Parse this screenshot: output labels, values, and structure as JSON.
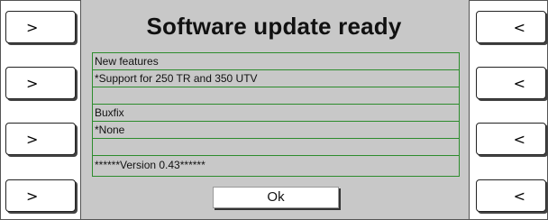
{
  "dialog": {
    "title": "Software update ready",
    "ok_label": "Ok"
  },
  "notes": {
    "lines": [
      "New features",
      "*Support for 250 TR  and 350 UTV",
      "",
      "Buxfix",
      "*None",
      "",
      "******Version 0.43******"
    ]
  },
  "softkeys": {
    "left": [
      ">",
      ">",
      ">",
      ">"
    ],
    "right": [
      "<",
      "<",
      "<",
      "<"
    ]
  },
  "colors": {
    "panel": "#c8c8c8",
    "notes_border": "#2d8c2d",
    "background": "#ffffff"
  }
}
